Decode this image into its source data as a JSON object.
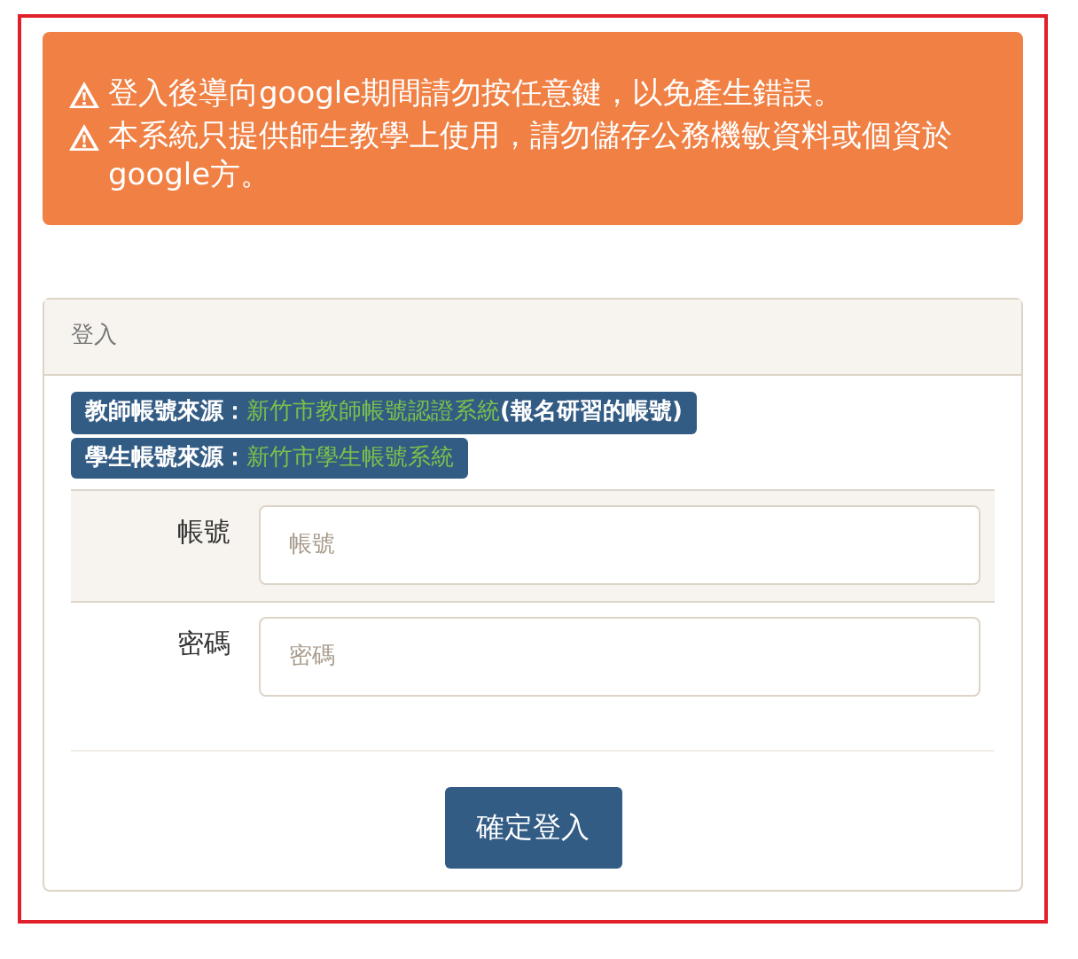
{
  "alerts": [
    "登入後導向google期間請勿按任意鍵，以免產生錯誤。",
    "本系統只提供師生教學上使用，請勿儲存公務機敏資料或個資於google方。"
  ],
  "panel": {
    "title": "登入",
    "sources": [
      {
        "label": "教師帳號來源：",
        "link": "新竹市教師帳號認證系統",
        "note": "(報名研習的帳號)"
      },
      {
        "label": "學生帳號來源：",
        "link": "新竹市學生帳號系統"
      }
    ],
    "fields": [
      {
        "label": "帳號",
        "placeholder": "帳號",
        "highlighted": true
      },
      {
        "label": "密碼",
        "placeholder": "密碼",
        "highlighted": false
      }
    ],
    "submit": "確定登入"
  }
}
